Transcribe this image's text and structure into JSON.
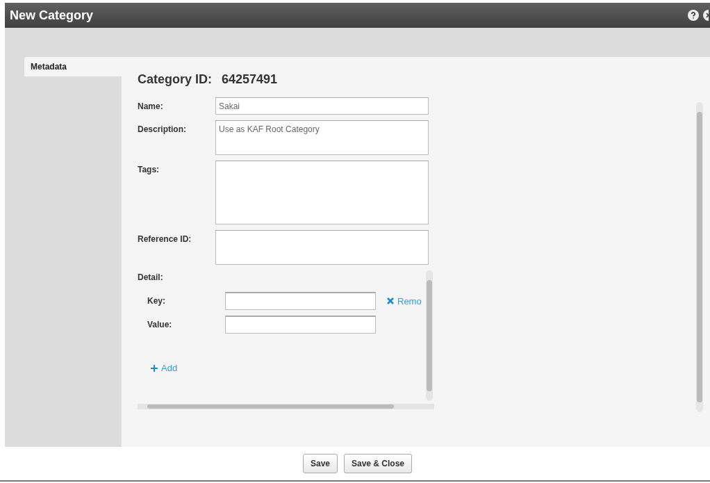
{
  "window": {
    "title": "New Category"
  },
  "tabs": [
    {
      "label": "Metadata",
      "selected": true
    }
  ],
  "category_id": {
    "label": "Category ID:",
    "value": "64257491"
  },
  "fields": [
    {
      "label": "Name:",
      "value": "Sakai",
      "kind": "text"
    },
    {
      "label": "Description:",
      "value": "Use as KAF Root Category",
      "kind": "textarea"
    },
    {
      "label": "Tags:",
      "kind": "tall"
    },
    {
      "label": "Reference ID:",
      "kind": "textarea"
    }
  ],
  "detail": {
    "label": "Detail:",
    "entries": [
      {
        "key_label": "Key:",
        "value_label": "Value:",
        "remove": "Remo"
      }
    ],
    "add": "Add"
  },
  "buttons": [
    "Save",
    "Save & Close"
  ]
}
